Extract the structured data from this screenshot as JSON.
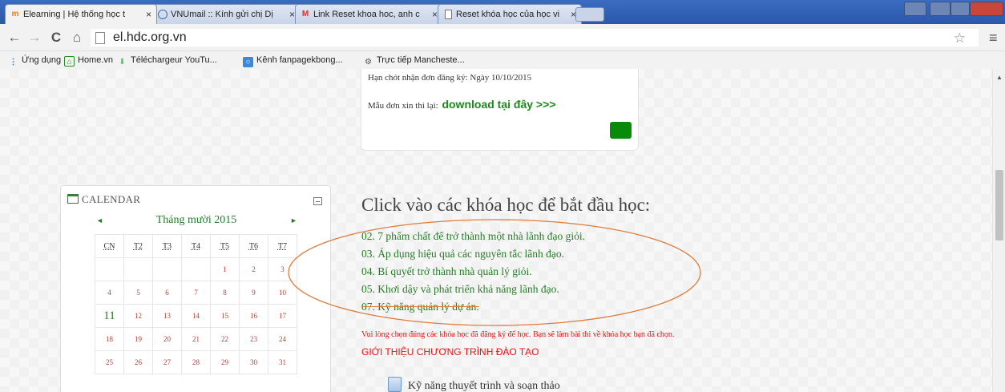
{
  "browser": {
    "tabs": [
      {
        "title": "Elearning | Hệ thống học t",
        "icon": "elearning-favicon",
        "active": true
      },
      {
        "title": "VNUmail :: Kính gửi chị Dị",
        "icon": "vnumail-favicon",
        "active": false
      },
      {
        "title": "Link Reset khoa hoc, anh c",
        "icon": "gmail-favicon",
        "active": false
      },
      {
        "title": "Reset khóa học của học vi",
        "icon": "doc-favicon",
        "active": false
      }
    ],
    "tab_close": "×",
    "url": "el.hdc.org.vn",
    "bookmarks": [
      {
        "label": "Ứng dụng",
        "icon": "apps-icon"
      },
      {
        "label": "Home.vn",
        "icon": "homevn-icon"
      },
      {
        "label": "Téléchargeur YouTu...",
        "icon": "downloader-icon"
      },
      {
        "label": "Kênh fanpagekbong...",
        "icon": "facebook-icon"
      },
      {
        "label": "Trực tiếp Mancheste...",
        "icon": "live-icon"
      }
    ]
  },
  "page": {
    "deadline": "Hạn chót nhận đơn đăng ký: Ngày 10/10/2015",
    "form_label": "Mẫu đơn xin thi lại:",
    "download_link": "download tại đây >>>",
    "calendar": {
      "title": "CALENDAR",
      "month": "Tháng mười 2015",
      "prev": "◄",
      "next": "►",
      "weekdays": [
        "CN",
        "T2",
        "T3",
        "T4",
        "T5",
        "T6",
        "T7"
      ],
      "weeks": [
        [
          "",
          "",
          "",
          "",
          "1",
          "2",
          "3"
        ],
        [
          "4",
          "5",
          "6",
          "7",
          "8",
          "9",
          "10"
        ],
        [
          "11",
          "12",
          "13",
          "14",
          "15",
          "16",
          "17"
        ],
        [
          "18",
          "19",
          "20",
          "21",
          "22",
          "23",
          "24"
        ],
        [
          "25",
          "26",
          "27",
          "28",
          "29",
          "30",
          "31"
        ]
      ],
      "today": "11"
    },
    "heading": "Click vào các khóa học để bắt đầu học:",
    "courses": [
      "02. 7 phẩm chất để trở thành một nhà lãnh đạo giỏi.",
      "03. Áp dụng hiệu quả các nguyên tắc lãnh đạo.",
      "04. Bí quyết trở thành nhà quản lý giỏi.",
      "05. Khơi dậy và phát triển khả năng lãnh đạo.",
      "07. Kỹ năng quản lý dự án."
    ],
    "notice": "Vui lòng chọn đúng các khóa học đã đăng ký để học. Bạn sẽ làm bài thi về khóa học bạn đã chọn.",
    "intro_heading": "GIỚI THIỆU CHƯƠNG TRÌNH ĐÀO TẠO",
    "program_item": "Kỹ năng thuyết trình và soạn thảo"
  },
  "colors": {
    "accent_green": "#2a7a2a",
    "link_green": "#1a8a1a",
    "alert_red": "#e11",
    "annotation_orange": "#e07b39"
  }
}
